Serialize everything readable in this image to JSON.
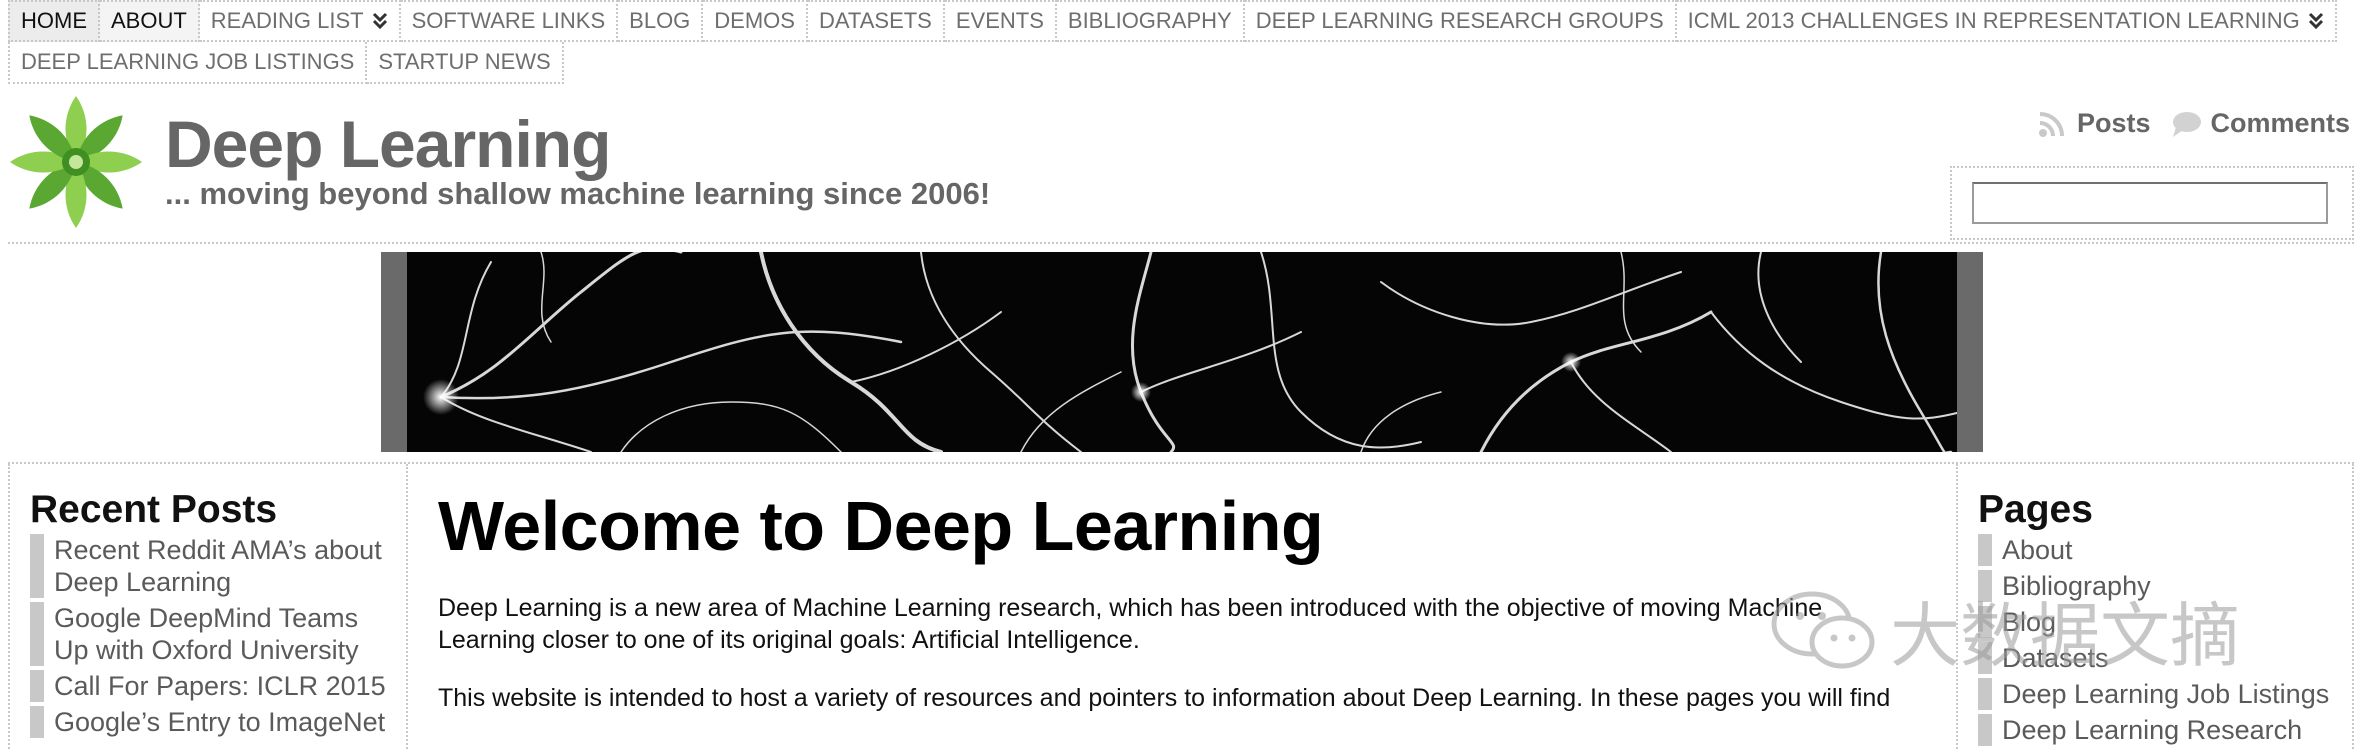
{
  "nav": {
    "row1": [
      {
        "label": "HOME",
        "state": "current"
      },
      {
        "label": "ABOUT",
        "state": "pale"
      },
      {
        "label": "READING LIST",
        "dropdown": true
      },
      {
        "label": "SOFTWARE LINKS"
      },
      {
        "label": "BLOG"
      },
      {
        "label": "DEMOS"
      },
      {
        "label": "DATASETS"
      },
      {
        "label": "EVENTS"
      },
      {
        "label": "BIBLIOGRAPHY"
      },
      {
        "label": "DEEP LEARNING RESEARCH GROUPS"
      },
      {
        "label": "ICML 2013 CHALLENGES IN REPRESENTATION LEARNING",
        "dropdown": true
      }
    ],
    "row2": [
      {
        "label": "DEEP LEARNING JOB LISTINGS"
      },
      {
        "label": "STARTUP NEWS"
      }
    ]
  },
  "header": {
    "title": "Deep Learning",
    "tagline": "... moving beyond shallow machine learning since 2006!",
    "posts_label": "Posts",
    "comments_label": "Comments",
    "search_value": ""
  },
  "recent_posts": {
    "title": "Recent Posts",
    "items": [
      "Recent Reddit AMA’s about Deep Learning",
      "Google DeepMind Teams Up with Oxford University",
      "Call For Papers: ICLR 2015",
      "Google’s Entry to ImageNet"
    ]
  },
  "main": {
    "heading": "Welcome to Deep Learning",
    "paragraphs": [
      "Deep Learning is a new area of Machine Learning research, which has been introduced with the objective of moving Machine Learning closer to one of its original goals: Artificial Intelligence.",
      "This website is intended to host a variety of resources and pointers to information about Deep Learning. In these pages you will find"
    ]
  },
  "pages": {
    "title": "Pages",
    "items": [
      "About",
      "Bibliography",
      "Blog",
      "Datasets",
      "Deep Learning Job Listings",
      "Deep Learning Research"
    ]
  },
  "watermark": {
    "text": "大数据文摘"
  },
  "colors": {
    "logo_green": "#7cc242",
    "text_gray": "#666666",
    "border_dots": "#c8c8c8"
  }
}
